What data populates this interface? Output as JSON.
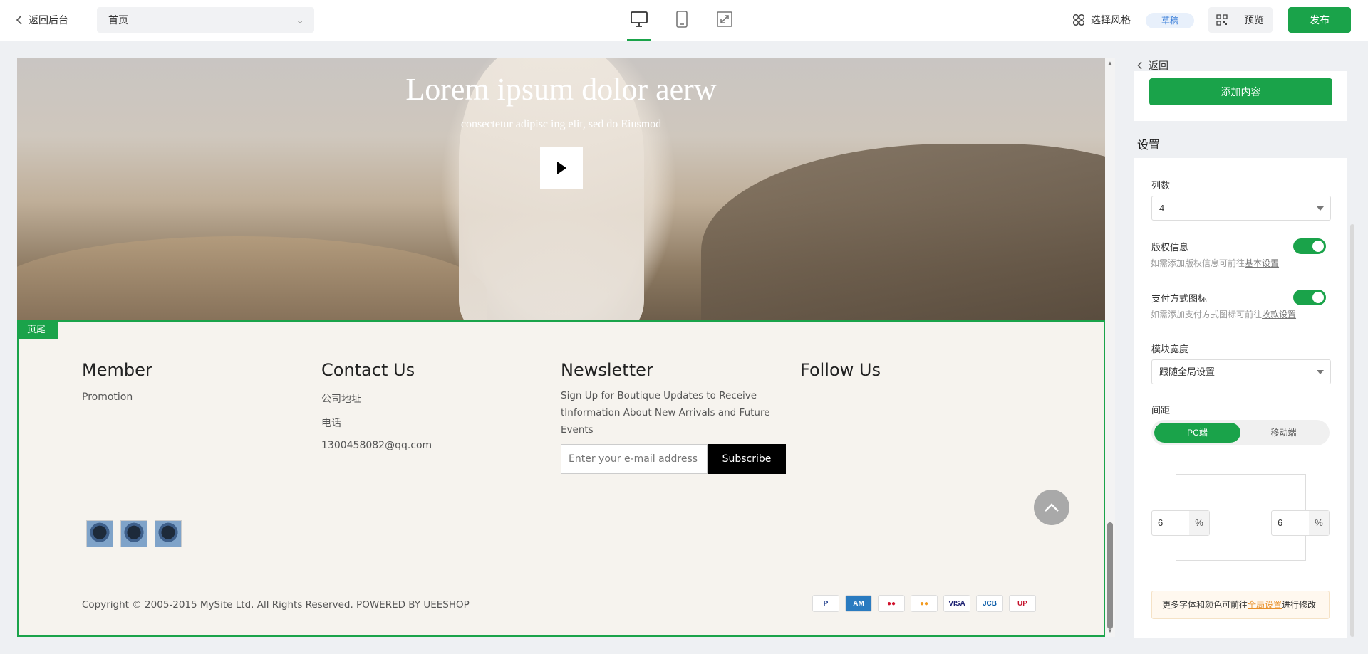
{
  "topbar": {
    "back_label": "返回后台",
    "page_select": "首页",
    "style_label": "选择风格",
    "draft_badge": "草稿",
    "preview_label": "预览",
    "publish_label": "发布",
    "devices": [
      "desktop-icon",
      "mobile-icon",
      "fullscreen-icon"
    ],
    "active_device": "desktop"
  },
  "canvas": {
    "hero": {
      "title": "Lorem ipsum dolor aerw",
      "subtitle": "consectetur adipisc ing elit, sed do Eiusmod"
    },
    "footer": {
      "tag": "页尾",
      "columns": [
        {
          "title": "Member",
          "links": [
            "Promotion"
          ]
        },
        {
          "title": "Contact Us",
          "links": [
            "公司地址",
            "电话",
            "1300458082@qq.com"
          ]
        },
        {
          "title": "Newsletter",
          "text": "Sign Up for Boutique Updates to Receive tInformation About New Arrivals and Future Events",
          "placeholder": "Enter your e-mail address",
          "button": "Subscribe"
        },
        {
          "title": "Follow Us"
        }
      ],
      "copyright": "Copyright © 2005-2015 MySite Ltd. All Rights Reserved. POWERED BY UEESHOP",
      "payment_icons": [
        "paypal-icon",
        "amex-icon",
        "maestro-icon",
        "mastercard-icon",
        "visa-icon",
        "jcb-icon",
        "unionpay-icon"
      ],
      "pay_labels": [
        "P",
        "AM",
        "●●",
        "●●",
        "VISA",
        "JCB",
        "UP"
      ]
    }
  },
  "panel": {
    "back_label": "返回",
    "add_content": "添加内容",
    "section_title": "设置",
    "columns_label": "列数",
    "columns_value": "4",
    "copyright_label": "版权信息",
    "copyright_hint": "如需添加版权信息可前往",
    "copyright_link": "基本设置",
    "copyright_on": true,
    "payicon_label": "支付方式图标",
    "payicon_hint": "如需添加支付方式图标可前往",
    "payicon_link": "收款设置",
    "payicon_on": true,
    "width_label": "模块宽度",
    "width_value": "跟随全局设置",
    "spacing_label": "间距",
    "seg_pc": "PC端",
    "seg_mobile": "移动端",
    "pad_left": "6",
    "pad_right": "6",
    "unit": "%",
    "note_prefix": "更多字体和颜色可前往",
    "note_link": "全局设置",
    "note_suffix": "进行修改"
  },
  "colors": {
    "accent": "#1aa34a",
    "note_link": "#e8902a"
  }
}
